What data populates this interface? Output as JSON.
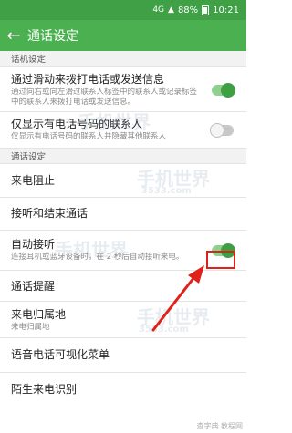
{
  "status_bar": {
    "network": "4G",
    "battery": "88%",
    "time": "10:21"
  },
  "app_bar": {
    "title": "通话设定"
  },
  "sections": [
    {
      "header": "话机设定",
      "rows": [
        {
          "title": "通过滑动来拨打电话或发送信息",
          "subtitle": "通过向右或向左滑过联系人标签中的联系人或记录标签中的联系人来拨打电话或发送信息。",
          "toggle": "on"
        },
        {
          "title": "仅显示有电话号码的联系人",
          "subtitle": "仅显示有电话号码的联系人并隐藏其他联系人",
          "toggle": "off"
        }
      ]
    },
    {
      "header": "通话设定",
      "rows": [
        {
          "title": "来电阻止"
        },
        {
          "title": "接听和结束通话"
        },
        {
          "title": "自动接听",
          "subtitle": "连接耳机或蓝牙设备时，在 2 秒后自动接听来电。",
          "toggle": "on"
        },
        {
          "title": "通话提醒"
        },
        {
          "title": "来电归属地",
          "subtitle": "来电归属地"
        },
        {
          "title": "语音电话可视化菜单"
        },
        {
          "title": "陌生来电识别"
        }
      ]
    }
  ],
  "watermarks": {
    "brand": "手机世界",
    "site": "3533.com",
    "footer": "查字典 教程网"
  },
  "colors": {
    "status_bar": "#3fa046",
    "app_bar": "#4bb050",
    "toggle_on": "#3e9f43",
    "annotation_red": "#e0211a"
  }
}
